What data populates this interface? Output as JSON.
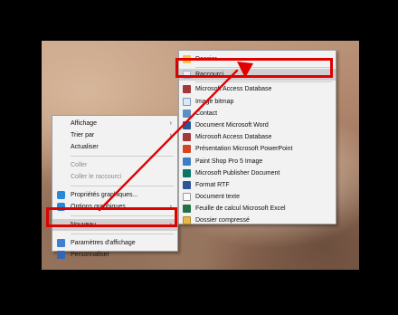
{
  "context_menu": {
    "items": [
      {
        "label": "Affichage",
        "has_submenu": true
      },
      {
        "label": "Trier par",
        "has_submenu": true
      },
      {
        "label": "Actualiser"
      },
      {
        "label": "Coller",
        "disabled": true
      },
      {
        "label": "Coller le raccourci",
        "disabled": true
      },
      {
        "label": "Propriétés graphiques...",
        "icon": "display-settings-icon"
      },
      {
        "label": "Options graphiques",
        "icon": "graphics-options-icon",
        "has_submenu": true
      },
      {
        "label": "Nouveau",
        "has_submenu": true,
        "highlighted": true
      },
      {
        "label": "Paramètres d'affichage",
        "icon": "display-icon"
      },
      {
        "label": "Personnaliser",
        "icon": "personalize-icon"
      }
    ]
  },
  "new_submenu": {
    "items": [
      {
        "label": "Dossier",
        "icon": "folder-icon"
      },
      {
        "label": "Raccourci",
        "icon": "shortcut-icon",
        "highlighted": true
      },
      {
        "label": "Microsoft Access Database",
        "icon": "access-icon"
      },
      {
        "label": "Image bitmap",
        "icon": "bitmap-icon"
      },
      {
        "label": "Contact",
        "icon": "contact-icon"
      },
      {
        "label": "Document Microsoft Word",
        "icon": "word-icon"
      },
      {
        "label": "Microsoft Access Database",
        "icon": "access-icon"
      },
      {
        "label": "Présentation Microsoft PowerPoint",
        "icon": "powerpoint-icon"
      },
      {
        "label": "Paint Shop Pro 5 Image",
        "icon": "paintshop-icon"
      },
      {
        "label": "Microsoft Publisher Document",
        "icon": "publisher-icon"
      },
      {
        "label": "Format RTF",
        "icon": "rtf-icon"
      },
      {
        "label": "Document texte",
        "icon": "text-icon"
      },
      {
        "label": "Feuille de calcul Microsoft Excel",
        "icon": "excel-icon"
      },
      {
        "label": "Dossier compressé",
        "icon": "zip-icon"
      }
    ]
  },
  "submenu_arrow": "›",
  "annotation_color": "#e00000"
}
